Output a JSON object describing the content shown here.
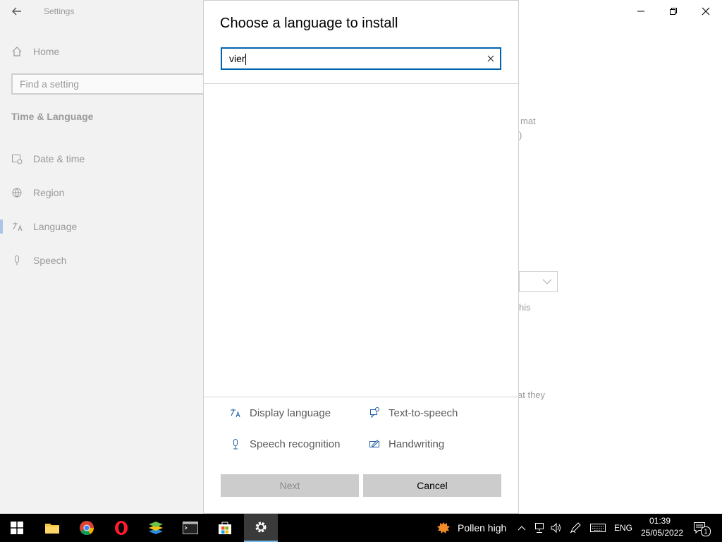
{
  "settings": {
    "title": "Settings",
    "nav_home": "Home",
    "search_placeholder": "Find a setting",
    "section": "Time & Language",
    "nav": [
      {
        "label": "Date & time",
        "icon": "calendar-clock-icon"
      },
      {
        "label": "Region",
        "icon": "globe-icon"
      },
      {
        "label": "Language",
        "icon": "language-icon"
      },
      {
        "label": "Speech",
        "icon": "microphone-icon"
      }
    ],
    "background_fragments": {
      "format": "mat",
      "paren": ")",
      "this": "his",
      "they": "at they"
    }
  },
  "dialog": {
    "title": "Choose a language to install",
    "search_value": "vier",
    "features": [
      {
        "label": "Display language",
        "icon": "display-language-icon"
      },
      {
        "label": "Text-to-speech",
        "icon": "text-to-speech-icon"
      },
      {
        "label": "Speech recognition",
        "icon": "microphone-icon"
      },
      {
        "label": "Handwriting",
        "icon": "handwriting-icon"
      }
    ],
    "next_label": "Next",
    "cancel_label": "Cancel"
  },
  "taskbar": {
    "weather_text": "Pollen high",
    "language": "ENG",
    "time": "01:39",
    "date": "25/05/2022",
    "notification_count": "1"
  },
  "colors": {
    "accent": "#0063b1",
    "sidebar_bg": "#f2f2f2",
    "button_bg": "#cccccc",
    "taskbar_bg": "#000000"
  }
}
